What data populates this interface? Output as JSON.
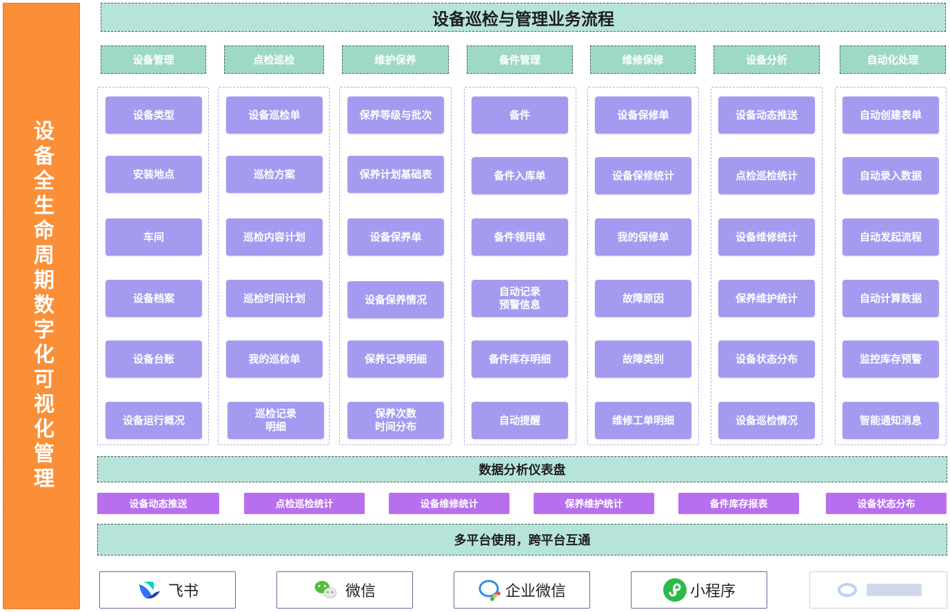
{
  "side_title": "设备全生命周期数字化可视化管理",
  "top_title": "设备巡检与管理业务流程",
  "categories": [
    {
      "label": "设备管理",
      "items": [
        "设备类型",
        "安装地点",
        "车间",
        "设备档案",
        "设备台账",
        "设备运行概况"
      ]
    },
    {
      "label": "点检巡检",
      "items": [
        "设备巡检单",
        "巡检方案",
        "巡检内容计划",
        "巡检时间计划",
        "我的巡检单",
        "巡检记录\n明细"
      ]
    },
    {
      "label": "维护保养",
      "items": [
        "保养等级与批次",
        "保养计划基础表",
        "设备保养单",
        "设备保养情况",
        "保养记录明细",
        "保养次数\n时间分布"
      ]
    },
    {
      "label": "备件管理",
      "items": [
        "备件",
        "备件入库单",
        "备件领用单",
        "自动记录\n预警信息",
        "备件库存明细",
        "自动提醒"
      ]
    },
    {
      "label": "维修保修",
      "items": [
        "设备保修单",
        "设备保修统计",
        "我的保修单",
        "故障原因",
        "故障类别",
        "维修工单明细"
      ]
    },
    {
      "label": "设备分析",
      "items": [
        "设备动态推送",
        "点检巡检统计",
        "设备维修统计",
        "保养维护统计",
        "设备状态分布",
        "设备巡检情况"
      ]
    },
    {
      "label": "自动化处理",
      "items": [
        "自动创建表单",
        "自动录入数据",
        "自动发起流程",
        "自动计算数据",
        "监控库存预警",
        "智能通知消息"
      ]
    }
  ],
  "dashboard_title": "数据分析仪表盘",
  "dashboard_items": [
    "设备动态推送",
    "点检巡检统计",
    "设备维修统计",
    "保养维护统计",
    "备件库存报表",
    "设备状态分布"
  ],
  "platform_title": "多平台使用，跨平台互通",
  "platforms": [
    {
      "label": "飞书",
      "icon": "feishu-icon"
    },
    {
      "label": "微信",
      "icon": "wechat-icon"
    },
    {
      "label": "企业微信",
      "icon": "wecom-icon"
    },
    {
      "label": "小程序",
      "icon": "miniprogram-icon"
    },
    {
      "label": "",
      "icon": "dingtalk-icon"
    }
  ],
  "colors": {
    "side_banner": "#fb8f38",
    "title_bar": "#b7e4da",
    "category_header": "#9ed9c7",
    "tile": "#a49bf1",
    "pill": "#b76ff0"
  }
}
